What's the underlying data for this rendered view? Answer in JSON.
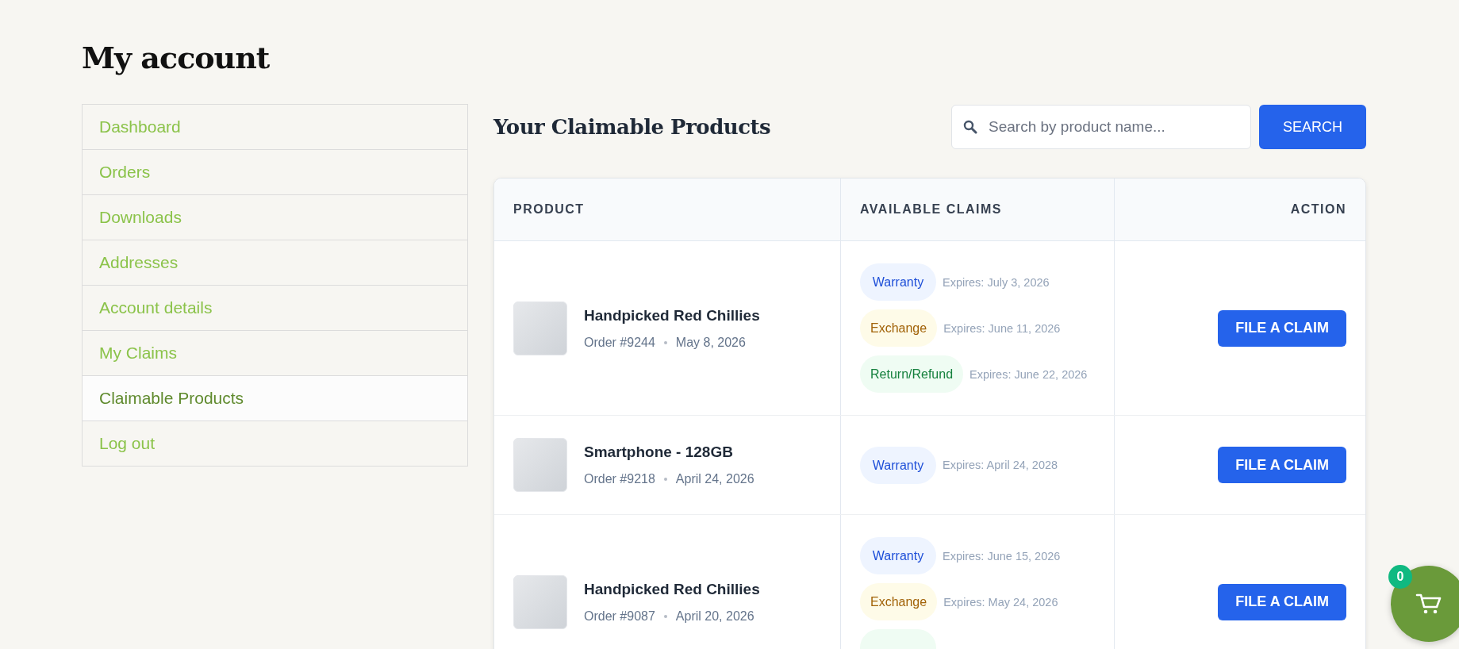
{
  "page_title": "My account",
  "nav": [
    {
      "label": "Dashboard",
      "selected": false
    },
    {
      "label": "Orders",
      "selected": false
    },
    {
      "label": "Downloads",
      "selected": false
    },
    {
      "label": "Addresses",
      "selected": false
    },
    {
      "label": "Account details",
      "selected": false
    },
    {
      "label": "My Claims",
      "selected": false
    },
    {
      "label": "Claimable Products",
      "selected": true
    },
    {
      "label": "Log out",
      "selected": false
    }
  ],
  "section_title": "Your Claimable Products",
  "search": {
    "placeholder": "Search by product name...",
    "button": "SEARCH"
  },
  "table": {
    "columns": [
      "PRODUCT",
      "AVAILABLE CLAIMS",
      "ACTION"
    ],
    "rows": [
      {
        "product": "Handpicked Red Chillies",
        "order": "Order #9244",
        "date": "May 8, 2026",
        "claims": [
          {
            "kind": "warranty",
            "label": "Warranty",
            "expires": "Expires: July 3, 2026"
          },
          {
            "kind": "exchange",
            "label": "Exchange",
            "expires": "Expires: June 11, 2026"
          },
          {
            "kind": "refund",
            "label": "Return/Refund",
            "expires": "Expires: June 22, 2026"
          }
        ],
        "action": "FILE A CLAIM"
      },
      {
        "product": "Smartphone - 128GB",
        "order": "Order #9218",
        "date": "April 24, 2026",
        "claims": [
          {
            "kind": "warranty",
            "label": "Warranty",
            "expires": "Expires: April 24, 2028"
          }
        ],
        "action": "FILE A CLAIM"
      },
      {
        "product": "Handpicked Red Chillies",
        "order": "Order #9087",
        "date": "April 20, 2026",
        "claims": [
          {
            "kind": "warranty",
            "label": "Warranty",
            "expires": "Expires: June 15, 2026"
          },
          {
            "kind": "exchange",
            "label": "Exchange",
            "expires": "Expires: May 24, 2026"
          },
          {
            "kind": "refund"
          }
        ],
        "action": "FILE A CLAIM"
      }
    ]
  },
  "cart": {
    "count": "0"
  }
}
